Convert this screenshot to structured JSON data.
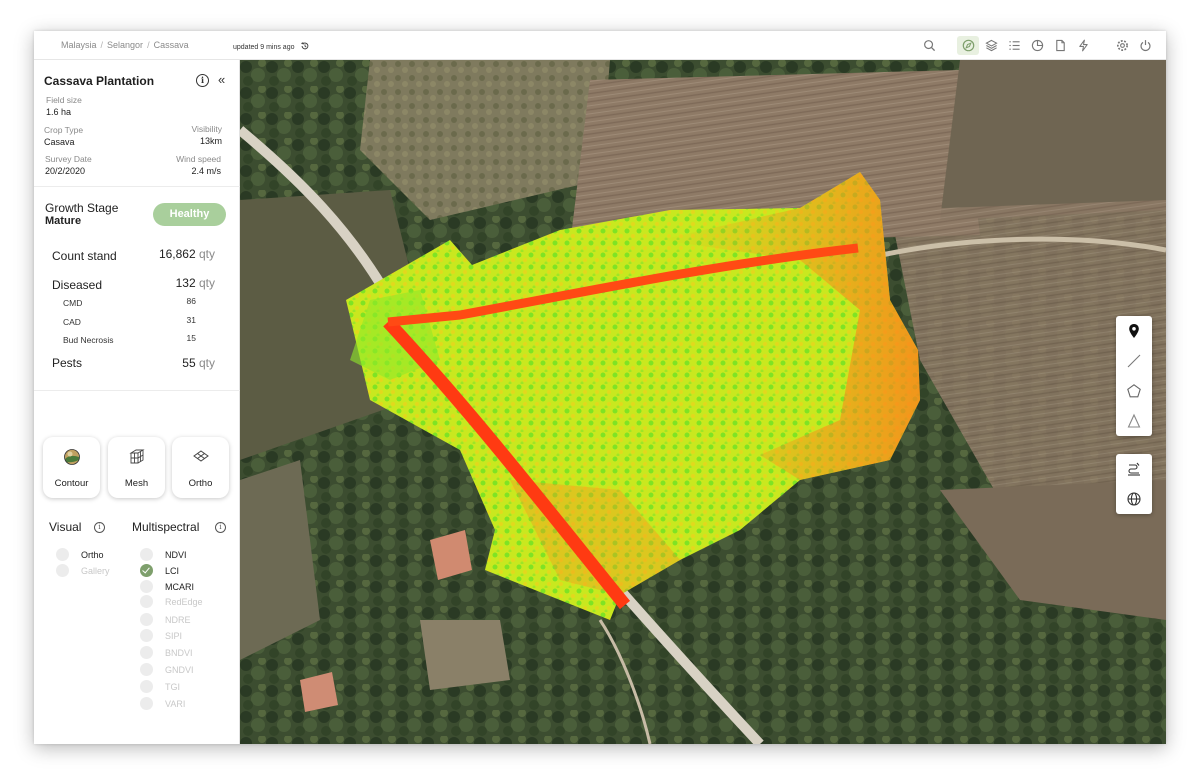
{
  "header": {
    "breadcrumb": [
      "Malaysia",
      "Selangor",
      "Cassava"
    ],
    "updated": "updated 9 mins ago",
    "icons": [
      "search-icon",
      "compass-icon",
      "layers-icon",
      "list-icon",
      "pie-chart-icon",
      "document-icon",
      "lightning-icon",
      "settings-icon",
      "power-icon"
    ],
    "active_icon": "compass-icon",
    "accent": "#7e9f6c"
  },
  "sidebar": {
    "title": "Cassava Plantation",
    "field_size": {
      "label": "Field size",
      "value": "1.6 ha"
    },
    "crop_type": {
      "label": "Crop Type",
      "value": "Casava"
    },
    "visibility": {
      "label": "Visibility",
      "value": "13km"
    },
    "survey_date": {
      "label": "Survey Date",
      "value": "20/2/2020"
    },
    "wind_speed": {
      "label": "Wind speed",
      "value": "2.4 m/s"
    },
    "growth_stage": {
      "label": "Growth Stage",
      "value": "Mature",
      "status": "Healthy",
      "status_color": "#a9cf9c"
    },
    "count_stand": {
      "label": "Count stand",
      "value": "16,862",
      "unit": "qty"
    },
    "diseased": {
      "label": "Diseased",
      "value": "132",
      "unit": "qty",
      "items": [
        {
          "label": "CMD",
          "value": "86"
        },
        {
          "label": "CAD",
          "value": "31"
        },
        {
          "label": "Bud Necrosis",
          "value": "15"
        }
      ]
    },
    "pests": {
      "label": "Pests",
      "value": "55",
      "unit": "qty"
    },
    "view_buttons": [
      {
        "label": "Contour",
        "icon": "contour-icon"
      },
      {
        "label": "Mesh",
        "icon": "cube-mesh-icon"
      },
      {
        "label": "Ortho",
        "icon": "ortho-layers-icon"
      }
    ],
    "visual": {
      "title": "Visual",
      "options": [
        {
          "label": "Ortho",
          "enabled": true,
          "checked": false
        },
        {
          "label": "Gallery",
          "enabled": false,
          "checked": false
        }
      ]
    },
    "multispectral": {
      "title": "Multispectral",
      "options": [
        {
          "label": "NDVI",
          "enabled": true,
          "checked": false
        },
        {
          "label": "LCI",
          "enabled": true,
          "checked": true
        },
        {
          "label": "MCARI",
          "enabled": true,
          "checked": false
        },
        {
          "label": "RedEdge",
          "enabled": false,
          "checked": false
        },
        {
          "label": "NDRE",
          "enabled": false,
          "checked": false
        },
        {
          "label": "SIPI",
          "enabled": false,
          "checked": false
        },
        {
          "label": "BNDVI",
          "enabled": false,
          "checked": false
        },
        {
          "label": "GNDVI",
          "enabled": false,
          "checked": false
        },
        {
          "label": "TGI",
          "enabled": false,
          "checked": false
        },
        {
          "label": "VARI",
          "enabled": false,
          "checked": false
        }
      ]
    }
  },
  "map_tools": {
    "draw": [
      "marker-icon",
      "line-icon",
      "polygon-icon",
      "triangle-icon"
    ],
    "view": [
      "terrain-icon",
      "globe-icon"
    ]
  }
}
